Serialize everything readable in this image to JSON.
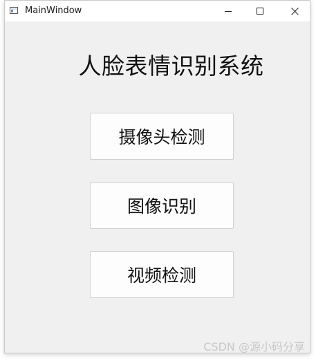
{
  "window": {
    "title": "MainWindow",
    "icon": "app-window-icon",
    "controls": {
      "minimize_icon": "minimize-icon",
      "maximize_icon": "maximize-icon",
      "close_icon": "close-icon"
    }
  },
  "main": {
    "title": "人脸表情识别系统",
    "buttons": [
      {
        "label": "摄像头检测"
      },
      {
        "label": "图像识别"
      },
      {
        "label": "视频检测"
      }
    ]
  },
  "watermark": {
    "text": "CSDN @源小码分享"
  },
  "colors": {
    "window_background": "#f0f0f0",
    "titlebar_background": "#ffffff",
    "button_background": "#fdfdfd",
    "button_border": "#d0d0d0",
    "text": "#111111"
  }
}
